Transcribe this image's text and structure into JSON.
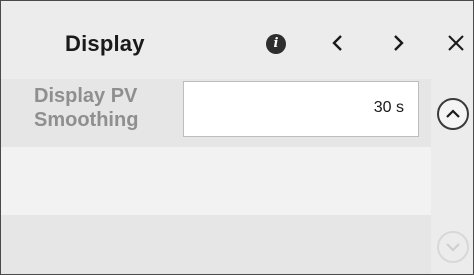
{
  "header": {
    "title": "Display",
    "info_icon": "info-icon",
    "prev_icon": "chevron-left-icon",
    "next_icon": "chevron-right-icon",
    "close_icon": "close-icon"
  },
  "settings": [
    {
      "label_line1": "Display PV",
      "label_line2": "Smoothing",
      "value": "30 s"
    }
  ],
  "scroll": {
    "up_icon": "chevron-up-icon",
    "down_icon": "chevron-down-icon",
    "down_enabled": false
  },
  "colors": {
    "background": "#f2f2f2",
    "row_alt": "#e6e6e6",
    "label_gray": "#8f8f8f",
    "text_dark": "#1a1a1a",
    "border": "#4a4a4a"
  }
}
